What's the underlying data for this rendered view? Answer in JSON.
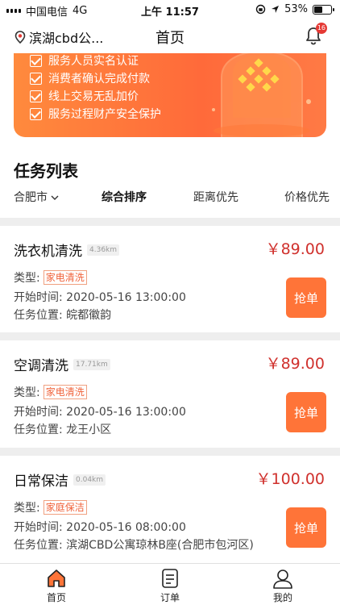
{
  "status_bar": {
    "carrier": "中国电信",
    "network": "4G",
    "time": "上午 11:57",
    "battery": "53%",
    "battery_level": 0.53
  },
  "nav": {
    "location": "滨湖cbd公...",
    "title": "首页",
    "notification_count": "16"
  },
  "banner": {
    "items": [
      "服务人员实名认证",
      "消费者确认完成付款",
      "线上交易无乱加价",
      "服务过程财产安全保护"
    ]
  },
  "section": {
    "title": "任务列表"
  },
  "filters": {
    "city": "合肥市",
    "comprehensive": "综合排序",
    "distance": "距离优先",
    "price": "价格优先"
  },
  "tasks": [
    {
      "title": "洗衣机清洗",
      "distance": "4.36km",
      "price": "￥89.00",
      "type_label": "类型:",
      "type": "家电清洗",
      "start_time": "开始时间: 2020-05-16 13:00:00",
      "location": "任务位置: 皖都徽韵",
      "grab": "抢单"
    },
    {
      "title": "空调清洗",
      "distance": "17.71km",
      "price": "￥89.00",
      "type_label": "类型:",
      "type": "家电清洗",
      "start_time": "开始时间: 2020-05-16 13:00:00",
      "location": "任务位置: 龙王小区",
      "grab": "抢单"
    },
    {
      "title": "日常保洁",
      "distance": "0.04km",
      "price": "￥100.00",
      "type_label": "类型:",
      "type": "家庭保洁",
      "start_time": "开始时间: 2020-05-16 08:00:00",
      "location": "任务位置: 滨湖CBD公寓琼林B座(合肥市包河区)",
      "grab": "抢单"
    }
  ],
  "tab_bar": {
    "home": "首页",
    "orders": "订单",
    "mine": "我的"
  },
  "colors": {
    "accent": "#ff7438",
    "price": "#d0312d",
    "banner": "#ff6a3a",
    "badge": "#e53935"
  }
}
